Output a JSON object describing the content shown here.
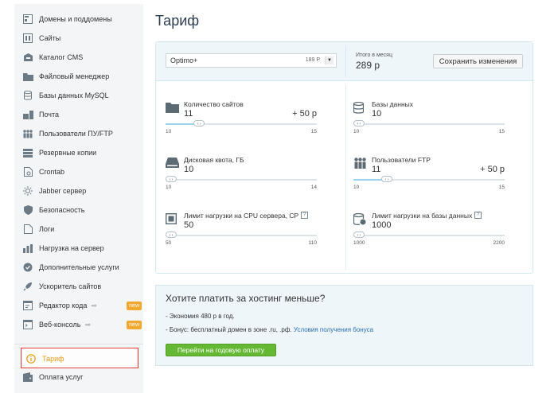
{
  "sidebar": {
    "items": [
      {
        "label": "Домены и поддомены"
      },
      {
        "label": "Сайты"
      },
      {
        "label": "Каталог CMS"
      },
      {
        "label": "Файловый менеджер"
      },
      {
        "label": "Базы данных MySQL"
      },
      {
        "label": "Почта"
      },
      {
        "label": "Пользователи ПУ/FTP"
      },
      {
        "label": "Резервные копии"
      },
      {
        "label": "Crontab"
      },
      {
        "label": "Jabber сервер"
      },
      {
        "label": "Безопасность"
      },
      {
        "label": "Логи"
      },
      {
        "label": "Нагрузка на сервер"
      },
      {
        "label": "Дополнительные услуги"
      },
      {
        "label": "Ускоритель сайтов"
      },
      {
        "label": "Редактор кода",
        "badge": "new"
      },
      {
        "label": "Веб-консоль",
        "badge": "new"
      }
    ],
    "active_item": {
      "label": "Тариф"
    },
    "bottom_item": {
      "label": "Оплата услуг"
    }
  },
  "page": {
    "title": "Тариф"
  },
  "tariff": {
    "plan": {
      "name": "Optimo+",
      "price": "189 Р"
    },
    "monthly_label": "Итого в месяц",
    "monthly_value": "289 р",
    "save_label": "Сохранить изменения",
    "params": [
      {
        "title": "Количество сайтов",
        "value": "11",
        "extra": "+ 50 р",
        "min": "10",
        "max": "15",
        "level": 0.2,
        "filled": true
      },
      {
        "title": "Базы данных",
        "value": "10",
        "min": "10",
        "max": "15",
        "level": 0.0,
        "filled": false
      },
      {
        "title": "Дисковая квота, ГБ",
        "value": "10",
        "min": "10",
        "max": "14",
        "level": 0.0,
        "filled": false
      },
      {
        "title": "Пользователи FTP",
        "value": "11",
        "extra": "+ 50 р",
        "min": "10",
        "max": "15",
        "level": 0.2,
        "filled": true
      },
      {
        "title": "Лимит нагрузки на CPU сервера, CP",
        "value": "50",
        "min": "50",
        "max": "110",
        "level": 0.0,
        "filled": false,
        "help": "?"
      },
      {
        "title": "Лимит нагрузки на базы данных",
        "value": "1000",
        "min": "1000",
        "max": "2200",
        "level": 0.0,
        "filled": false,
        "help": "?"
      }
    ]
  },
  "promo": {
    "title": "Хотите платить за хостинг меньше?",
    "line1": "- Экономия 480 р в год.",
    "line2": "- Бонус: бесплатный домен в зоне .ru, .рф.",
    "link": "Условия получения бонуса",
    "button": "Перейти на годовую оплату"
  },
  "colors": {
    "accent_green": "#65b833",
    "active_highlight": "#e53935",
    "active_text": "#e69b14",
    "badge": "#f0a830",
    "link": "#2a6fb0"
  }
}
